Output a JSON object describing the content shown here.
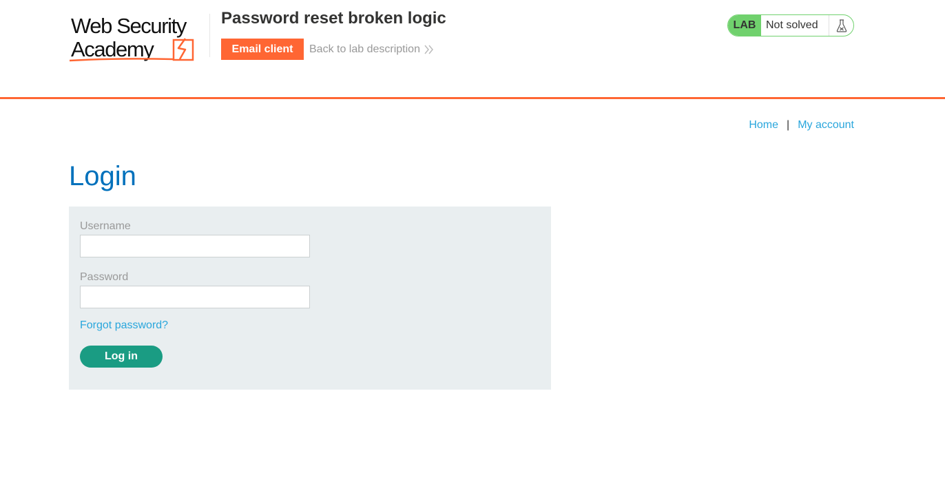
{
  "header": {
    "logo_text": [
      "Web Security",
      "Academy"
    ],
    "lab_title": "Password reset broken logic",
    "email_client_label": "Email client",
    "back_link_label": "Back to lab description",
    "lab_badge": "LAB",
    "lab_status": "Not solved"
  },
  "nav": {
    "home": "Home",
    "separator": "|",
    "my_account": "My account"
  },
  "login": {
    "heading": "Login",
    "username_label": "Username",
    "username_value": "",
    "password_label": "Password",
    "password_value": "",
    "forgot_password": "Forgot password?",
    "submit_label": "Log in"
  },
  "colors": {
    "brand_orange": "#ff6633",
    "lab_green": "#70d16d",
    "link_blue": "#29a6dc",
    "heading_blue": "#0071bc",
    "button_green": "#1a9c83",
    "panel_bg": "#e9eef0"
  },
  "icons": {
    "back": "double-chevron-right-icon",
    "flask": "flask-icon",
    "logo_mark": "lightning-icon"
  }
}
